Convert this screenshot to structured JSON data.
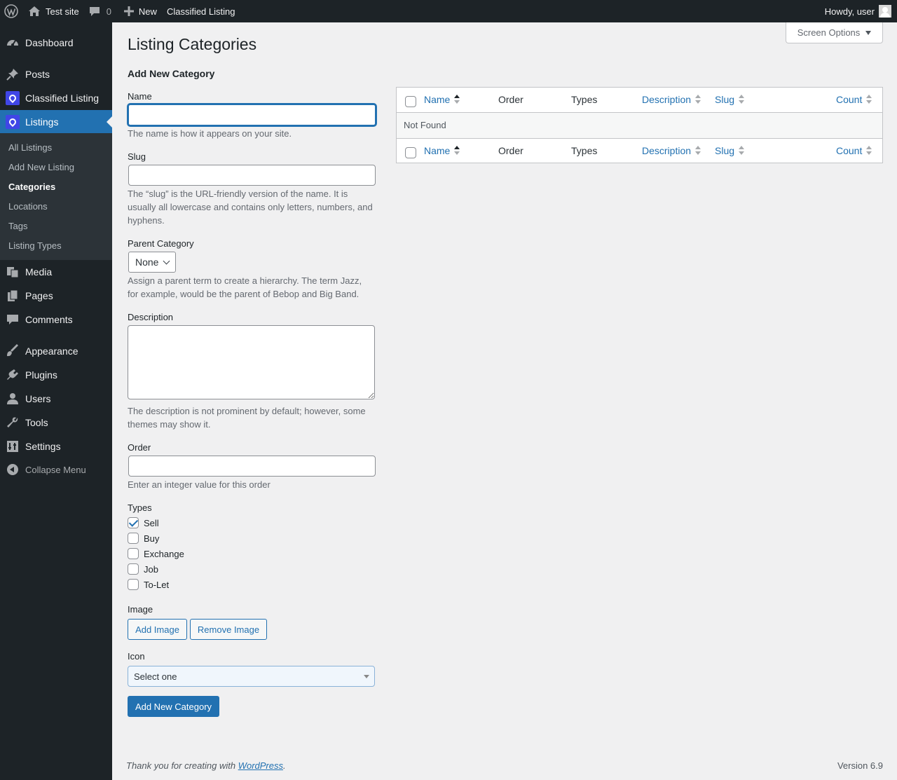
{
  "admin_bar": {
    "site_name": "Test site",
    "comments_count": "0",
    "new_label": "New",
    "plugin_link": "Classified Listing",
    "greeting": "Howdy, user"
  },
  "sidebar": {
    "items": [
      {
        "label": "Dashboard",
        "icon": "dashboard-icon"
      },
      {
        "label": "Posts",
        "icon": "pin-icon"
      },
      {
        "label": "Classified Listing",
        "icon": "classified-listing-icon"
      },
      {
        "label": "Listings",
        "icon": "classified-listing-icon"
      },
      {
        "label": "Media",
        "icon": "media-icon"
      },
      {
        "label": "Pages",
        "icon": "pages-icon"
      },
      {
        "label": "Comments",
        "icon": "comment-icon"
      },
      {
        "label": "Appearance",
        "icon": "brush-icon"
      },
      {
        "label": "Plugins",
        "icon": "plug-icon"
      },
      {
        "label": "Users",
        "icon": "user-icon"
      },
      {
        "label": "Tools",
        "icon": "wrench-icon"
      },
      {
        "label": "Settings",
        "icon": "settings-icon"
      }
    ],
    "submenu": [
      "All Listings",
      "Add New Listing",
      "Categories",
      "Locations",
      "Tags",
      "Listing Types"
    ],
    "collapse": "Collapse Menu"
  },
  "screen_options": "Screen Options",
  "page_title": "Listing Categories",
  "form": {
    "heading": "Add New Category",
    "name_label": "Name",
    "name_value": "",
    "name_help": "The name is how it appears on your site.",
    "slug_label": "Slug",
    "slug_value": "",
    "slug_help": "The “slug” is the URL-friendly version of the name. It is usually all lowercase and contains only letters, numbers, and hyphens.",
    "parent_label": "Parent Category",
    "parent_value": "None",
    "parent_help": "Assign a parent term to create a hierarchy. The term Jazz, for example, would be the parent of Bebop and Big Band.",
    "description_label": "Description",
    "description_value": "",
    "description_help": "The description is not prominent by default; however, some themes may show it.",
    "order_label": "Order",
    "order_value": "",
    "order_help": "Enter an integer value for this order",
    "types_label": "Types",
    "types": [
      {
        "label": "Sell",
        "checked": true
      },
      {
        "label": "Buy",
        "checked": false
      },
      {
        "label": "Exchange",
        "checked": false
      },
      {
        "label": "Job",
        "checked": false
      },
      {
        "label": "To-Let",
        "checked": false
      }
    ],
    "image_label": "Image",
    "add_image": "Add Image",
    "remove_image": "Remove Image",
    "icon_label": "Icon",
    "icon_select": "Select one",
    "submit": "Add New Category"
  },
  "table": {
    "columns": [
      "Name",
      "Order",
      "Types",
      "Description",
      "Slug",
      "Count"
    ],
    "empty": "Not Found"
  },
  "footer": {
    "thanks_prefix": "Thank you for creating with ",
    "wp_link": "WordPress",
    "thanks_suffix": ".",
    "version": "Version 6.9"
  },
  "colors": {
    "accent": "#2271b1",
    "sidebar_bg": "#1d2327",
    "plugin_icon": "#4046e6"
  }
}
